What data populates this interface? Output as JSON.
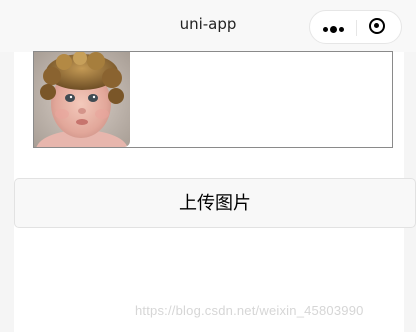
{
  "navbar": {
    "title": "uni-app",
    "capsule": {
      "more_icon": "more-dots-icon",
      "close_icon": "target-circle-icon"
    }
  },
  "image_picker": {
    "images": [
      {
        "description": "photo-thumbnail",
        "icon": "baby-photo"
      }
    ]
  },
  "upload_button": {
    "label": "上传图片"
  },
  "watermark": {
    "text": "https://blog.csdn.net/weixin_45803990"
  },
  "colors": {
    "navbar_bg": "#f8f8f8",
    "button_bg": "#f8f8f8",
    "border": "#8a8a8a",
    "watermark": "#d2d2d2"
  }
}
